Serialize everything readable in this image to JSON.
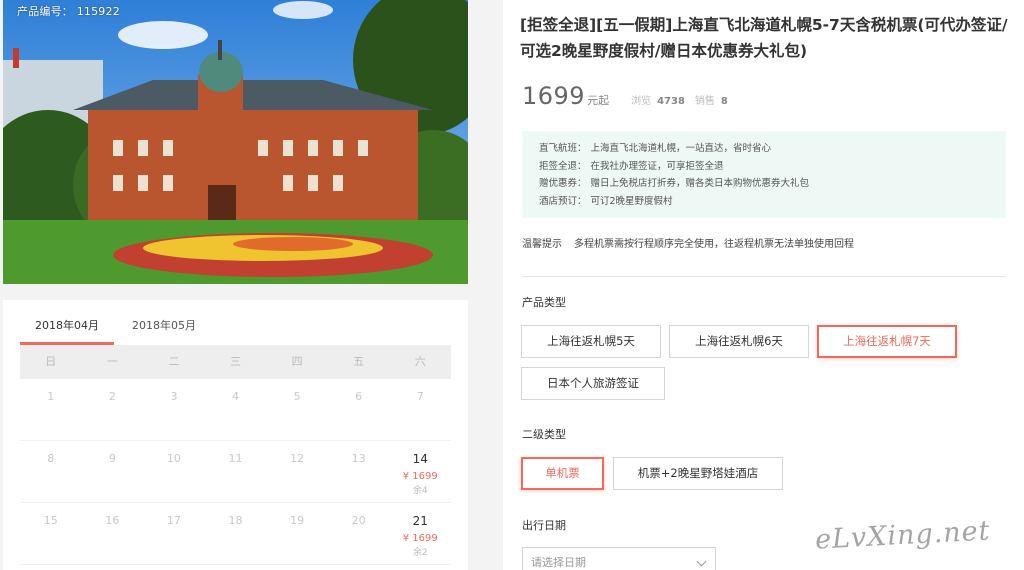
{
  "product": {
    "id_label": "产品编号： 115922",
    "title": "[拒签全退][五一假期]上海直飞北海道札幌5-7天含税机票(可代办签证/可选2晚星野度假村/赠日本优惠券大礼包)",
    "price": "1699",
    "price_unit": "元起",
    "views_label": "浏览",
    "views": "4738",
    "sales_label": "销售",
    "sales": "8"
  },
  "features": [
    {
      "key": "直飞航班：",
      "text": "上海直飞北海道札幌，一站直达，省时省心"
    },
    {
      "key": "拒签全退：",
      "text": "在我社办理签证，可享拒签全退"
    },
    {
      "key": "赠优惠券：",
      "text": "赠日上免税店打折券，赠各类日本购物优惠券大礼包"
    },
    {
      "key": "酒店预订：",
      "text": "可订2晚星野度假村"
    }
  ],
  "notice": {
    "key": "温馨提示",
    "text": "多程机票需按行程顺序完全使用，往返程机票无法单独使用回程"
  },
  "product_type": {
    "label": "产品类型",
    "options": [
      "上海往返札幌5天",
      "上海往返札幌6天",
      "上海往返札幌7天",
      "日本个人旅游签证"
    ],
    "selected": 2
  },
  "sub_type": {
    "label": "二级类型",
    "options": [
      "单机票",
      "机票+2晚星野塔娃酒店"
    ],
    "selected": 0
  },
  "departure": {
    "label": "出行日期",
    "placeholder": "请选择日期"
  },
  "calendar": {
    "tabs": [
      "2018年04月",
      "2018年05月"
    ],
    "active_tab": 0,
    "weekdays": [
      "日",
      "一",
      "二",
      "三",
      "四",
      "五",
      "六"
    ],
    "weeks": [
      [
        {
          "d": "1"
        },
        {
          "d": "2"
        },
        {
          "d": "3"
        },
        {
          "d": "4"
        },
        {
          "d": "5"
        },
        {
          "d": "6"
        },
        {
          "d": "7"
        }
      ],
      [
        {
          "d": "8"
        },
        {
          "d": "9"
        },
        {
          "d": "10"
        },
        {
          "d": "11"
        },
        {
          "d": "12"
        },
        {
          "d": "13"
        },
        {
          "d": "14",
          "price": "¥ 1699",
          "stock": "余4"
        }
      ],
      [
        {
          "d": "15"
        },
        {
          "d": "16"
        },
        {
          "d": "17"
        },
        {
          "d": "18"
        },
        {
          "d": "19"
        },
        {
          "d": "20"
        },
        {
          "d": "21",
          "price": "¥ 1699",
          "stock": "余2"
        }
      ]
    ]
  },
  "watermark": "eLvXing.net",
  "colors": {
    "accent": "#f26a5e",
    "feature_bg": "#eef8f4"
  }
}
